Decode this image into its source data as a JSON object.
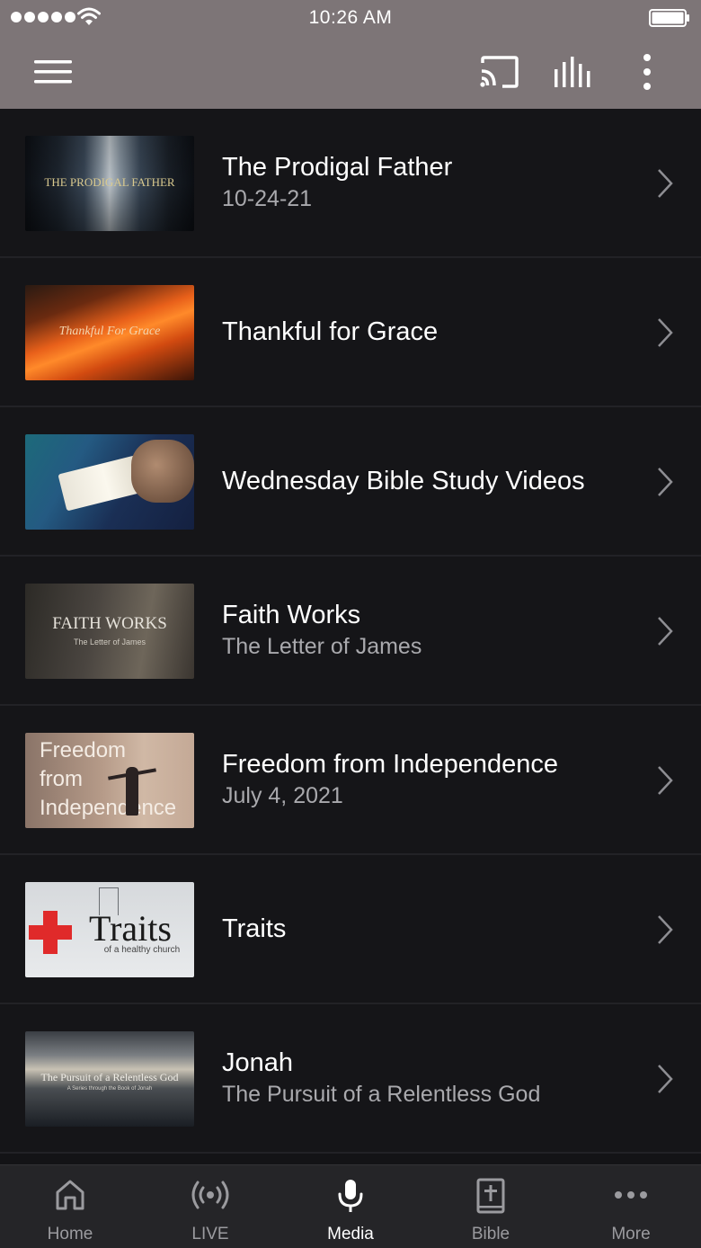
{
  "status_bar": {
    "time": "10:26 AM"
  },
  "header": {
    "menu_icon": "hamburger-menu-icon",
    "cast_icon": "cast-icon",
    "audio_icon": "audio-bars-icon",
    "more_icon": "vertical-more-icon",
    "bg_color": "#7d7577"
  },
  "media": {
    "items": [
      {
        "title": "The Prodigal Father",
        "subtitle": "10-24-21",
        "thumb_text": "THE PRODIGAL FATHER"
      },
      {
        "title": "Thankful for Grace",
        "subtitle": "",
        "thumb_text": "Thankful For Grace"
      },
      {
        "title": "Wednesday Bible Study Videos",
        "subtitle": "",
        "thumb_text": ""
      },
      {
        "title": "Faith Works",
        "subtitle": "The Letter of James",
        "thumb_text": "FAITH WORKS",
        "thumb_sub": "The Letter of James"
      },
      {
        "title": "Freedom from Independence",
        "subtitle": "July 4, 2021",
        "thumb_text": "Freedom from Independence"
      },
      {
        "title": "Traits",
        "subtitle": "",
        "thumb_text": "Traits",
        "thumb_sub": "of a healthy church"
      },
      {
        "title": "Jonah",
        "subtitle": "The Pursuit of a Relentless God",
        "thumb_text": "The Pursuit of a Relentless God",
        "thumb_sub": "A Series through the Book of Jonah"
      }
    ]
  },
  "tabs": [
    {
      "label": "Home",
      "icon": "home-icon"
    },
    {
      "label": "LIVE",
      "icon": "broadcast-icon"
    },
    {
      "label": "Media",
      "icon": "microphone-icon",
      "active": true
    },
    {
      "label": "Bible",
      "icon": "bible-icon"
    },
    {
      "label": "More",
      "icon": "more-dots-icon"
    }
  ]
}
